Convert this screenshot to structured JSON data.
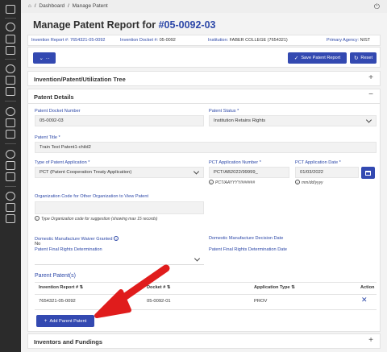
{
  "breadcrumb": {
    "dashboard": "Dashboard",
    "current": "Manage Patent",
    "separator": "/"
  },
  "page": {
    "title_prefix": "Manage Patent Report for",
    "title_id": "#05-0092-03"
  },
  "info_bar": {
    "invention_report_label": "Invention Report #:",
    "invention_report_value": "7654321-05-0092",
    "invention_docket_label": "Invention Docket #:",
    "invention_docket_value": "05-0092",
    "institution_label": "Institution:",
    "institution_value": "FABER COLLEGE (7654321)",
    "primary_agency_label": "Primary Agency:",
    "primary_agency_value": "NIST"
  },
  "actions": {
    "dropdown_label": "...",
    "save_label": "Save Patent Report",
    "reset_label": "Reset"
  },
  "sections": {
    "tree_title": "Invention/Patent/Utilization Tree",
    "details_title": "Patent Details",
    "inventors_title": "Inventors and Fundings"
  },
  "details": {
    "docket_label": "Patent Docket Number",
    "docket_value": "05-0092-03",
    "status_label": "Patent Status *",
    "status_value": "Institution Retains Rights",
    "title_label": "Patent Title *",
    "title_value": "Train Test Patent1-child2",
    "type_label": "Type of Patent Application *",
    "type_value": "PCT (Patent Cooperation Treaty Application)",
    "pct_number_label": "PCT Application Number *",
    "pct_number_value": "PCT/AB2022/99999_",
    "pct_number_hint": "PCT/AAYYYY/######",
    "pct_date_label": "PCT Application Date *",
    "pct_date_value": "01/03/2022",
    "pct_date_hint": "mm/dd/yyyy",
    "org_code_label": "Organization Code for Other Organization to View Patent",
    "org_code_value": "",
    "org_code_hint": "Type Organization code for suggestion (showing max 15 records)",
    "waiver_label": "Domestic Manufacture Waiver Granted",
    "waiver_value": "No",
    "decision_date_label": "Domestic Manufacture Decision Date",
    "final_rights_label": "Patent Final Rights Determination",
    "final_rights_value": "",
    "final_rights_date_label": "Patent Final Rights Determination Date"
  },
  "parent_patents": {
    "title": "Parent Patent(s)",
    "columns": {
      "invention_report": "Invention Report #",
      "docket": "Docket #",
      "application_type": "Application Type",
      "action": "Action"
    },
    "rows": [
      {
        "invention_report": "7654321-05-0092",
        "docket": "05-0092-01",
        "application_type": "PROV"
      }
    ],
    "add_label": "Add Parent Patent"
  },
  "colors": {
    "accent": "#3349b1",
    "link": "#2d48a8",
    "rail": "#2b2b2b",
    "annotation_arrow": "#e01c1c"
  }
}
